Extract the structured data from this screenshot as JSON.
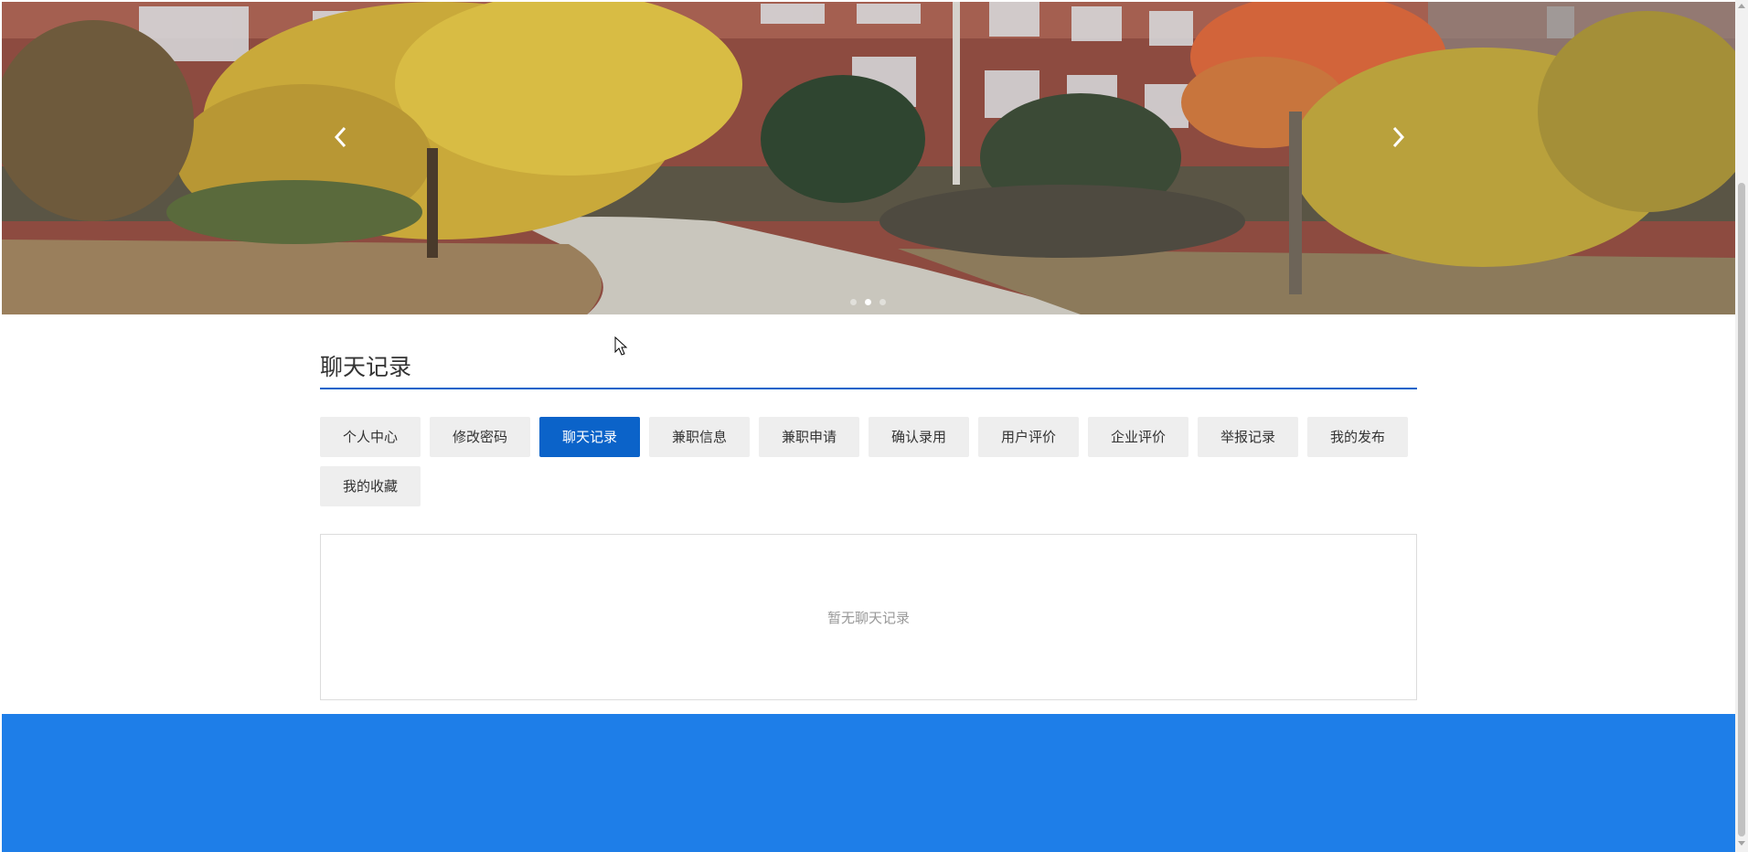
{
  "banner": {
    "prev_icon": "chevron-left-icon",
    "next_icon": "chevron-right-icon",
    "slide_count": 3,
    "active_slide": 2
  },
  "page": {
    "title": "聊天记录"
  },
  "tabs": [
    {
      "label": "个人中心",
      "active": false
    },
    {
      "label": "修改密码",
      "active": false
    },
    {
      "label": "聊天记录",
      "active": true
    },
    {
      "label": "兼职信息",
      "active": false
    },
    {
      "label": "兼职申请",
      "active": false
    },
    {
      "label": "确认录用",
      "active": false
    },
    {
      "label": "用户评价",
      "active": false
    },
    {
      "label": "企业评价",
      "active": false
    },
    {
      "label": "举报记录",
      "active": false
    },
    {
      "label": "我的发布",
      "active": false
    },
    {
      "label": "我的收藏",
      "active": false
    }
  ],
  "chat": {
    "empty_message": "暂无聊天记录"
  },
  "colors": {
    "accent": "#0b63c9",
    "footer": "#1e7ee8",
    "tab_bg": "#eeeeee"
  }
}
